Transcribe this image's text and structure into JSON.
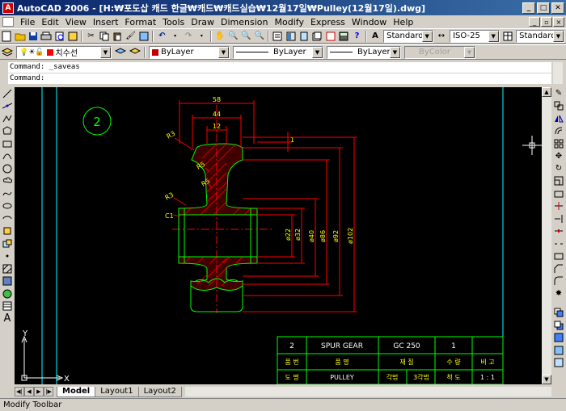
{
  "window": {
    "title": "AutoCAD 2006 - [H:₩포도삽 캐드 한글₩캐드₩캐드실습₩12월17일₩Pulley(12월17일).dwg]",
    "controls": [
      "_",
      "□",
      "✕"
    ]
  },
  "menu": {
    "items": [
      "File",
      "Edit",
      "View",
      "Insert",
      "Format",
      "Tools",
      "Draw",
      "Dimension",
      "Modify",
      "Express",
      "Window",
      "Help"
    ]
  },
  "toolbar_styles": {
    "text_style": "Standard",
    "dim_style": "ISO-25",
    "table_style": "Standard"
  },
  "layers": {
    "current_layer": "치수선",
    "color": "ByLayer",
    "linetype": "ByLayer",
    "lineweight": "ByLayer",
    "plot_style": "ByColor"
  },
  "command": {
    "history": "Command: _saveas",
    "prompt": "Command:"
  },
  "tabs": [
    "Model",
    "Layout1",
    "Layout2"
  ],
  "status": "Modify Toolbar",
  "drawing": {
    "view_number": "2",
    "radius_labels": [
      "R3",
      "R5",
      "R5",
      "R3"
    ],
    "chamfer_label": "C1",
    "top_dims": [
      "58",
      "44",
      "12"
    ],
    "side_mark": "1",
    "diameter_dims": [
      "ø22",
      "ø32",
      "ø40",
      "ø86",
      "ø92",
      "ø102"
    ],
    "ucs_x": "X",
    "ucs_y": "Y",
    "title_block": {
      "row1": [
        "2",
        "SPUR GEAR",
        "GC 250",
        "1",
        ""
      ],
      "row2": [
        "품 번",
        "품  명",
        "재  질",
        "수 량",
        "비 고"
      ],
      "row3": [
        "도 명",
        "PULLEY",
        "각법",
        "3각법",
        "척 도",
        "1 : 1"
      ]
    }
  },
  "colors": {
    "canvas": "#000000",
    "object": "#00ff00",
    "dimension": "#ff0000",
    "label": "#ffff00",
    "hatch": "#ff0000",
    "border": "#00ffff"
  }
}
